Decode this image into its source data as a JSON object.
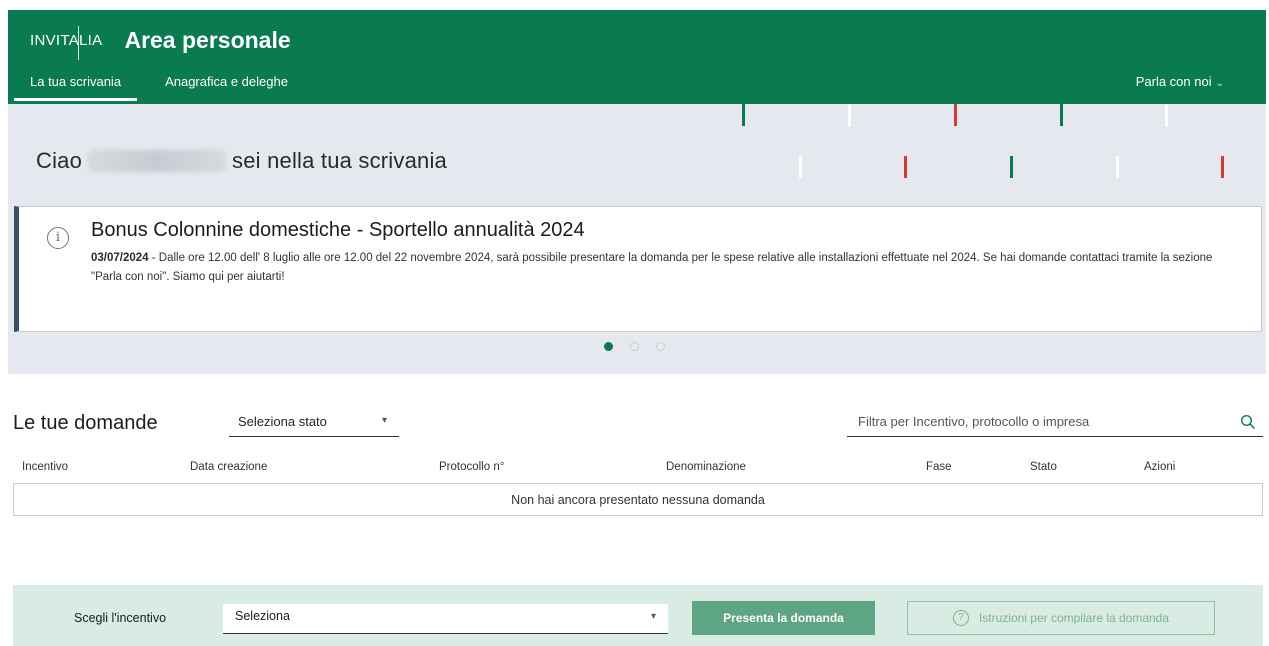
{
  "header": {
    "logo": "INVITALIA",
    "title": "Area personale",
    "nav": [
      {
        "label": "La tua scrivania",
        "active": true
      },
      {
        "label": "Anagrafica e deleghe",
        "active": false
      }
    ],
    "contact_label": "Parla con noi",
    "brand_color": "#0a7a50"
  },
  "welcome": {
    "prefix": "Ciao",
    "suffix": "sei nella tua scrivania"
  },
  "announcement": {
    "title": "Bonus Colonnine domestiche - Sportello annualità 2024",
    "date": "03/07/2024",
    "text": " - Dalle ore 12.00 dell' 8 luglio alle ore 12.00 del 22 novembre 2024, sarà possibile presentare la domanda per le spese relative alle installazioni effettuate nel 2024. Se hai domande contattaci tramite la sezione \"Parla con noi\". Siamo qui per aiutarti!",
    "carousel_active_index": 0,
    "carousel_total": 3
  },
  "domande": {
    "title": "Le tue domande",
    "stato_select_value": "Seleziona stato",
    "filter_placeholder": "Filtra per Incentivo, protocollo o impresa",
    "columns": [
      "Incentivo",
      "Data creazione",
      "Protocollo n°",
      "Denominazione",
      "Fase",
      "Stato",
      "Azioni"
    ],
    "empty_message": "Non hai ancora presentato nessuna domanda"
  },
  "bottom": {
    "label": "Scegli l'incentivo",
    "select_value": "Seleziona",
    "submit_label": "Presenta la domanda",
    "instructions_label": "Istruzioni per compilare la domanda"
  }
}
